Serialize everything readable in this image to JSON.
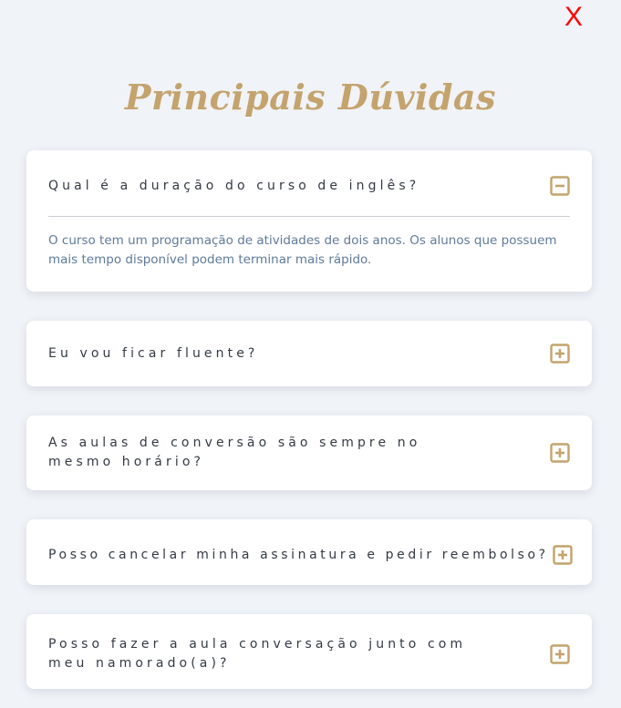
{
  "close_label": "X",
  "title": "Principais Dúvidas",
  "colors": {
    "accent": "#c4a36d",
    "close": "#ff0000",
    "background": "#f0f3f7",
    "answer_text": "#5e7a9a",
    "question_text": "#333a44"
  },
  "faq": [
    {
      "question": "Qual é a duração do curso de inglês?",
      "answer": "O curso tem um programação de atividades de dois anos. Os alunos que possuem mais tempo disponível podem terminar mais rápido.",
      "expanded": true,
      "icon": "minus-square-icon"
    },
    {
      "question": "Eu vou ficar fluente?",
      "expanded": false,
      "icon": "plus-square-icon"
    },
    {
      "question": "As aulas de conversão são sempre no mesmo horário?",
      "expanded": false,
      "icon": "plus-square-icon"
    },
    {
      "question": "Posso cancelar minha assinatura e pedir reembolso?",
      "expanded": false,
      "icon": "plus-square-icon"
    },
    {
      "question": "Posso fazer a aula conversação junto com meu namorado(a)?",
      "expanded": false,
      "icon": "plus-square-icon"
    }
  ]
}
